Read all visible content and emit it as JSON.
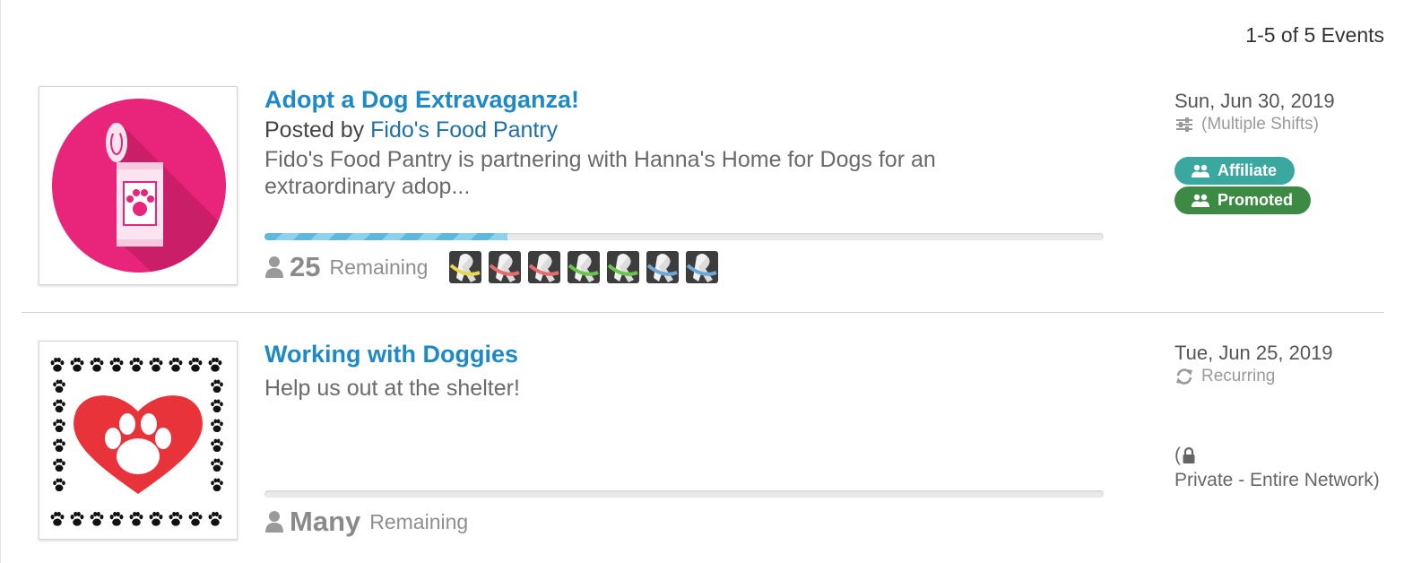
{
  "results": {
    "count_text": "1-5 of 5 Events"
  },
  "events": [
    {
      "title": "Adopt a Dog Extravaganza!",
      "posted_prefix": "Posted by",
      "organizer": "Fido's Food Pantry",
      "description": "Fido's Food Pantry is partnering with Hanna's Home for Dogs for an extraordinary adop...",
      "progress_fraction": 0.29,
      "remaining_count": "25",
      "remaining_label": "Remaining",
      "ribbon_colors": [
        "#e8d84a",
        "#e86a6a",
        "#e86a6a",
        "#6ac64a",
        "#6ac64a",
        "#6fa8d8",
        "#6fa8d8"
      ],
      "date": "Sun, Jun 30, 2019",
      "schedule_note": "(Multiple Shifts)",
      "schedule_icon": "sliders-icon",
      "badges": [
        {
          "label": "Affiliate",
          "color": "#3aa89e",
          "icon": "users-icon"
        },
        {
          "label": "Promoted",
          "color": "#3d8a45",
          "icon": "users-icon"
        }
      ]
    },
    {
      "title": "Working with Doggies",
      "description": "Help us out at the shelter!",
      "progress_fraction": 0,
      "remaining_count": "Many",
      "remaining_label": "Remaining",
      "date": "Tue, Jun 25, 2019",
      "schedule_note": "Recurring",
      "schedule_icon": "refresh-icon",
      "privacy_open": "(",
      "privacy_text": "Private - Entire Network)",
      "privacy_icon": "lock-icon"
    }
  ],
  "colors": {
    "link": "#1e88c8",
    "accent_bar": "#5db8dc",
    "thumb_pink": "#e8257b"
  }
}
